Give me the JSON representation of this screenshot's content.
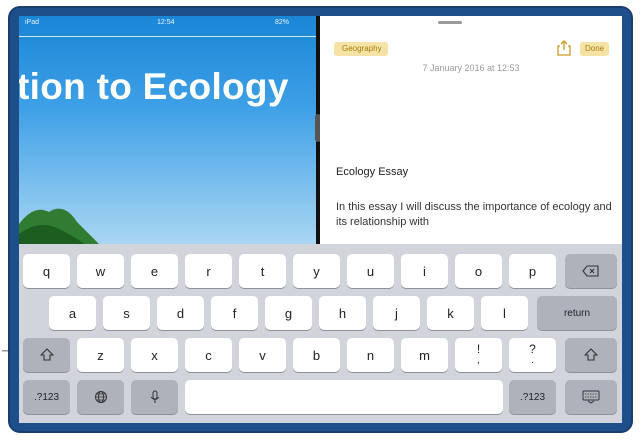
{
  "status_bar": {
    "carrier": "iPad",
    "time": "12:54",
    "battery": "82%"
  },
  "slide": {
    "title": "tion to Ecology"
  },
  "note": {
    "back_label": "Geography",
    "done_label": "Done",
    "date": "7 January 2016 at 12:53",
    "heading": "Ecology Essay",
    "body": "In this essay I will discuss the importance of ecology and its relationship with"
  },
  "keyboard": {
    "row1": [
      "q",
      "w",
      "e",
      "r",
      "t",
      "y",
      "u",
      "i",
      "o",
      "p"
    ],
    "row2": [
      "a",
      "s",
      "d",
      "f",
      "g",
      "h",
      "j",
      "k",
      "l"
    ],
    "return_label": "return",
    "row3": [
      "z",
      "x",
      "c",
      "v",
      "b",
      "n",
      "m"
    ],
    "punct1": [
      "!",
      ","
    ],
    "punct2": [
      "?",
      "."
    ],
    "numbers_label": ".?123"
  },
  "colors": {
    "frame": "#1f4f8a",
    "notes_accent": "#a77d10",
    "slide_blue": "#1a86d6"
  }
}
